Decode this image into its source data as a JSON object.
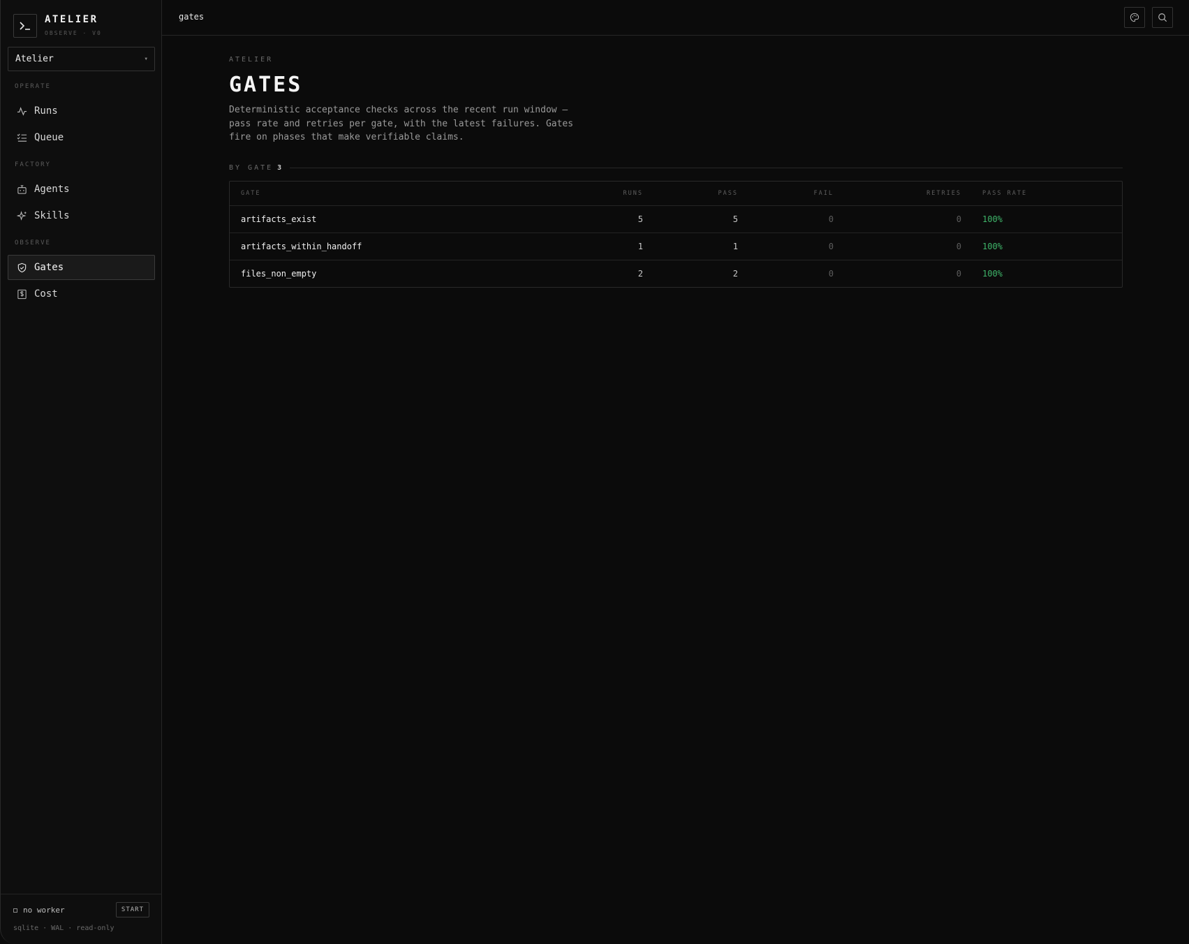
{
  "brand": {
    "title": "ATELIER",
    "subtitle": "OBSERVE · V0",
    "mark": ">_"
  },
  "workspace": {
    "selected": "Atelier"
  },
  "nav": {
    "sections": [
      {
        "label": "OPERATE",
        "items": [
          {
            "label": "Runs",
            "icon": "activity-icon"
          },
          {
            "label": "Queue",
            "icon": "list-checks-icon"
          }
        ]
      },
      {
        "label": "FACTORY",
        "items": [
          {
            "label": "Agents",
            "icon": "bot-icon"
          },
          {
            "label": "Skills",
            "icon": "sparkles-icon"
          }
        ]
      },
      {
        "label": "OBSERVE",
        "items": [
          {
            "label": "Gates",
            "icon": "shield-icon",
            "active": true
          },
          {
            "label": "Cost",
            "icon": "dollar-square-icon"
          }
        ]
      }
    ]
  },
  "footer": {
    "worker_status": "no worker",
    "start_label": "START",
    "meta": "sqlite · WAL · read-only"
  },
  "topbar": {
    "breadcrumb": "gates",
    "icons": [
      "palette-icon",
      "search-icon"
    ]
  },
  "page": {
    "eyebrow": "ATELIER",
    "title": "GATES",
    "description": "Deterministic acceptance checks across the recent run window — pass rate and retries per gate, with the latest failures. Gates fire on phases that make verifiable claims."
  },
  "group": {
    "label": "BY GATE",
    "count": "3"
  },
  "table": {
    "columns": [
      "GATE",
      "RUNS",
      "PASS",
      "FAIL",
      "RETRIES",
      "PASS RATE"
    ],
    "rows": [
      {
        "gate": "artifacts_exist",
        "runs": "5",
        "pass": "5",
        "fail": "0",
        "retries": "0",
        "rate": "100%"
      },
      {
        "gate": "artifacts_within_handoff",
        "runs": "1",
        "pass": "1",
        "fail": "0",
        "retries": "0",
        "rate": "100%"
      },
      {
        "gate": "files_non_empty",
        "runs": "2",
        "pass": "2",
        "fail": "0",
        "retries": "0",
        "rate": "100%"
      }
    ]
  },
  "colors": {
    "accent_pass": "#3fb66a",
    "background": "#0b0b0b",
    "border": "#2a2a2a"
  }
}
